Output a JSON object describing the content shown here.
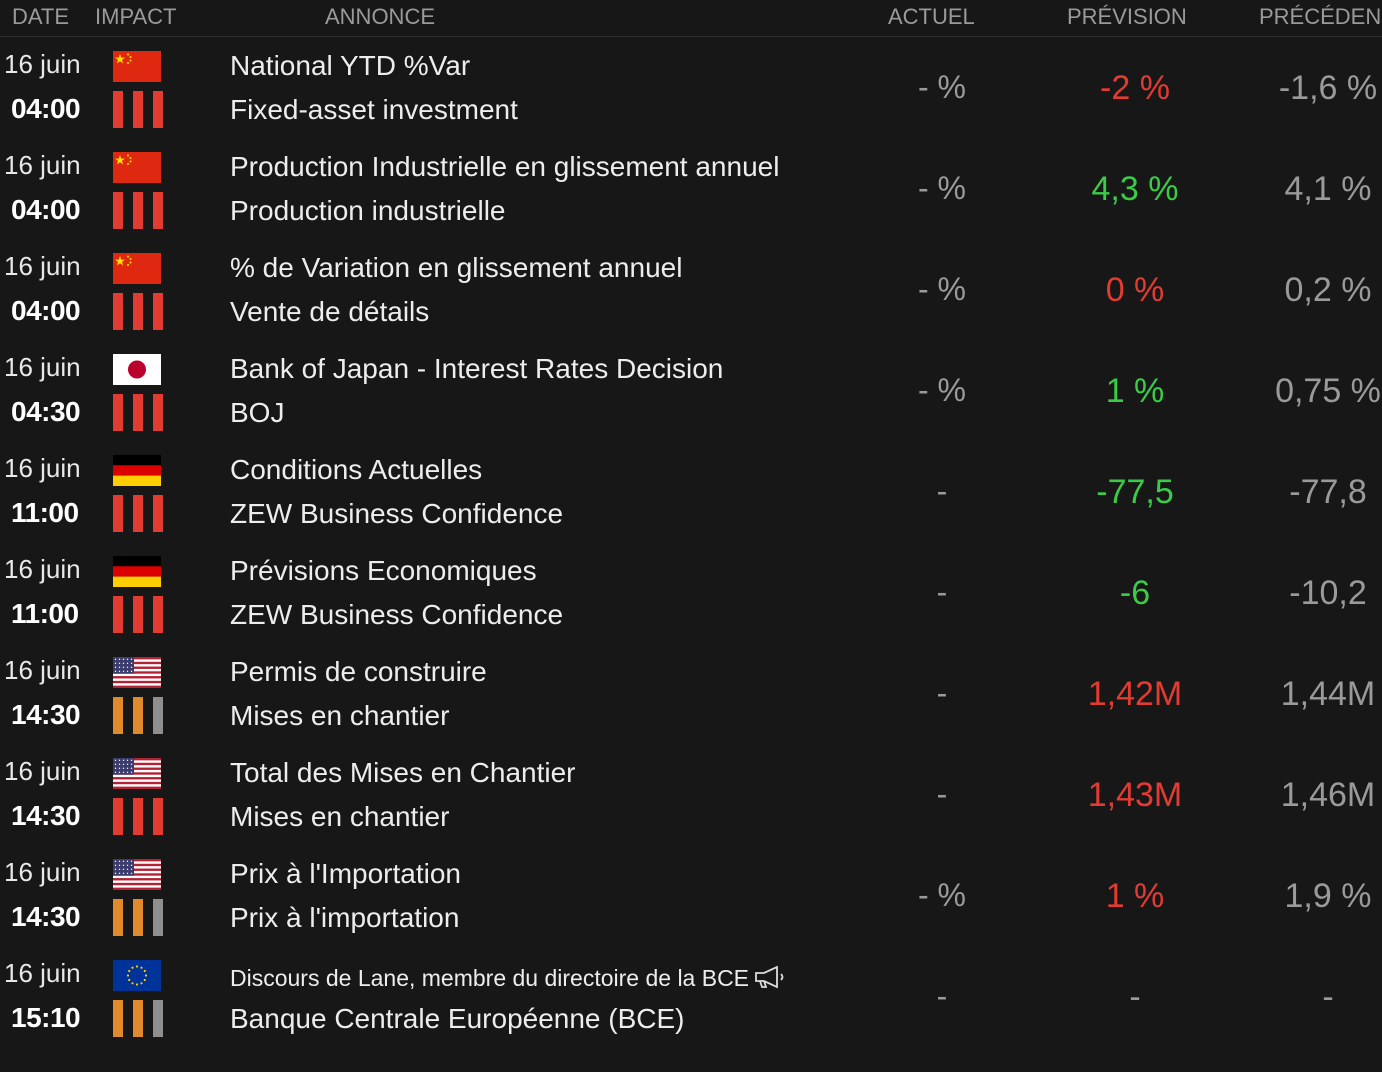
{
  "colors": {
    "red": "#e23b32",
    "green": "#3bcb47",
    "orange": "#e08a2b",
    "grey_bar": "#8f8f8f"
  },
  "header": {
    "date": "DATE",
    "impact": "IMPACT",
    "annonce": "ANNONCE",
    "actuel": "ACTUEL",
    "prevision": "PRÉVISION",
    "precedent": "PRÉCÉDEN"
  },
  "rows": [
    {
      "date": "16 juin",
      "time": "04:00",
      "country": "china",
      "flag_icon": "china-flag-icon",
      "impact": [
        "red",
        "red",
        "red"
      ],
      "title": "National YTD %Var",
      "subtitle": "Fixed-asset investment",
      "actuel": "- %",
      "prevision": "-2 %",
      "prevision_color": "red",
      "precedent": "-1,6 %"
    },
    {
      "date": "16 juin",
      "time": "04:00",
      "country": "china",
      "flag_icon": "china-flag-icon",
      "impact": [
        "red",
        "red",
        "red"
      ],
      "title": "Production Industrielle en glissement annuel",
      "subtitle": "Production industrielle",
      "actuel": "- %",
      "prevision": "4,3 %",
      "prevision_color": "green",
      "precedent": "4,1 %"
    },
    {
      "date": "16 juin",
      "time": "04:00",
      "country": "china",
      "flag_icon": "china-flag-icon",
      "impact": [
        "red",
        "red",
        "red"
      ],
      "title": "% de Variation en glissement annuel",
      "subtitle": "Vente de détails",
      "actuel": "- %",
      "prevision": "0 %",
      "prevision_color": "red",
      "precedent": "0,2 %"
    },
    {
      "date": "16 juin",
      "time": "04:30",
      "country": "japan",
      "flag_icon": "japan-flag-icon",
      "impact": [
        "red",
        "red",
        "red"
      ],
      "title": "Bank of Japan - Interest Rates Decision",
      "subtitle": "BOJ",
      "actuel": "- %",
      "prevision": "1 %",
      "prevision_color": "green",
      "precedent": "0,75 %"
    },
    {
      "date": "16 juin",
      "time": "11:00",
      "country": "germany",
      "flag_icon": "germany-flag-icon",
      "impact": [
        "red",
        "red",
        "red"
      ],
      "title": "Conditions Actuelles",
      "subtitle": "ZEW Business Confidence",
      "actuel": "-",
      "prevision": "-77,5",
      "prevision_color": "green",
      "precedent": "-77,8"
    },
    {
      "date": "16 juin",
      "time": "11:00",
      "country": "germany",
      "flag_icon": "germany-flag-icon",
      "impact": [
        "red",
        "red",
        "red"
      ],
      "title": "Prévisions Economiques",
      "subtitle": "ZEW Business Confidence",
      "actuel": "-",
      "prevision": "-6",
      "prevision_color": "green",
      "precedent": "-10,2"
    },
    {
      "date": "16 juin",
      "time": "14:30",
      "country": "usa",
      "flag_icon": "usa-flag-icon",
      "impact": [
        "orange",
        "orange",
        "grey"
      ],
      "title": "Permis de construire",
      "subtitle": "Mises en chantier",
      "actuel": "-",
      "prevision": "1,42M",
      "prevision_color": "red",
      "precedent": "1,44M"
    },
    {
      "date": "16 juin",
      "time": "14:30",
      "country": "usa",
      "flag_icon": "usa-flag-icon",
      "impact": [
        "red",
        "red",
        "red"
      ],
      "title": "Total des Mises en Chantier",
      "subtitle": "Mises en chantier",
      "actuel": "-",
      "prevision": "1,43M",
      "prevision_color": "red",
      "precedent": "1,46M"
    },
    {
      "date": "16 juin",
      "time": "14:30",
      "country": "usa",
      "flag_icon": "usa-flag-icon",
      "impact": [
        "orange",
        "orange",
        "grey"
      ],
      "title": "Prix à l'Importation",
      "subtitle": "Prix à l'importation",
      "actuel": "- %",
      "prevision": "1 %",
      "prevision_color": "red",
      "precedent": "1,9 %"
    },
    {
      "date": "16 juin",
      "time": "15:10",
      "country": "eu",
      "flag_icon": "eu-flag-icon",
      "impact": [
        "orange",
        "orange",
        "grey"
      ],
      "title": "Discours de Lane, membre du directoire de la BCE",
      "title_small": true,
      "has_megaphone": true,
      "subtitle": "Banque Centrale Européenne (BCE)",
      "actuel": "-",
      "prevision": "-",
      "prevision_color": "grey",
      "precedent": "-"
    }
  ]
}
